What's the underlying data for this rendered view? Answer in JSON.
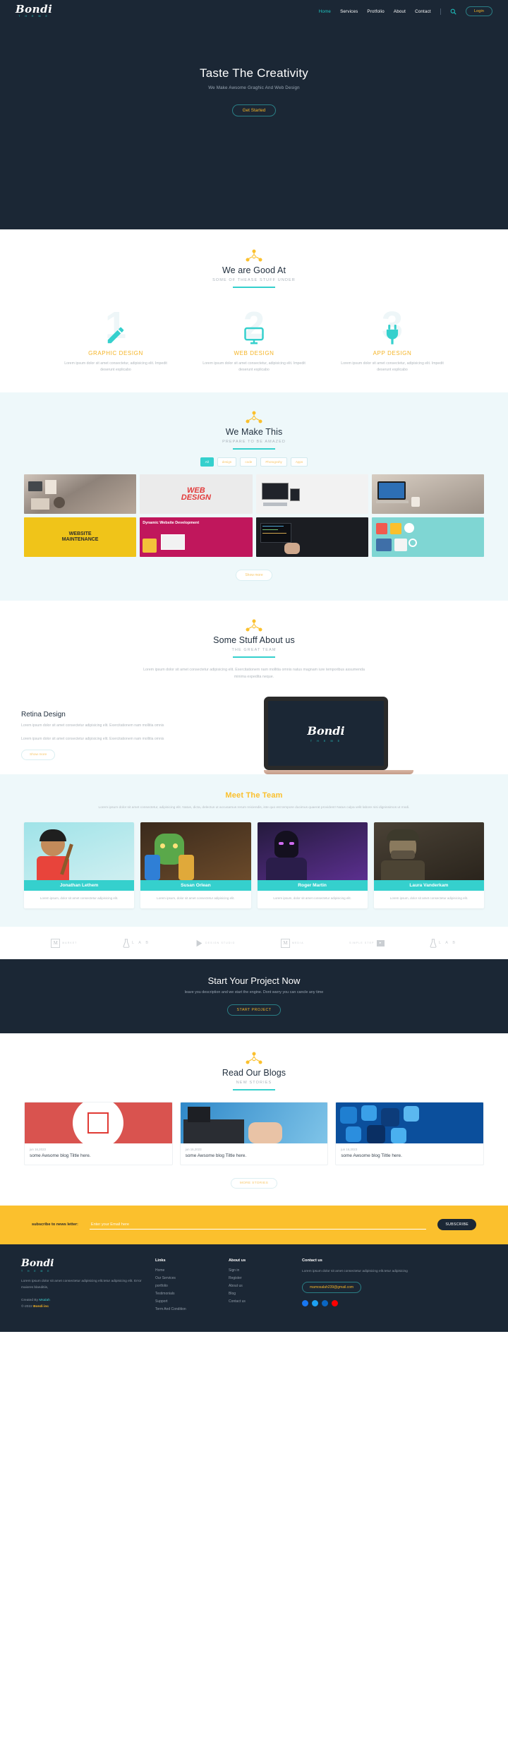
{
  "colors": {
    "dark": "#1b2735",
    "teal": "#35d0cd",
    "yellow": "#fbc02d",
    "amber": "#f5b425",
    "light_bg": "#eef8fa"
  },
  "brand": {
    "name": "Bondi",
    "tagline": "T H E M E"
  },
  "nav": {
    "links": [
      {
        "label": "Home",
        "active": true
      },
      {
        "label": "Services",
        "active": false
      },
      {
        "label": "Protfolio",
        "active": false
      },
      {
        "label": "About",
        "active": false
      },
      {
        "label": "Contact",
        "active": false
      }
    ],
    "search_icon": "search-icon",
    "login_label": "Login"
  },
  "hero": {
    "title": "Taste The Creativity",
    "subtitle": "We Make Awsome Graghic And Web Design",
    "button": "Get Started"
  },
  "goodat": {
    "title": "We are Good At",
    "subtitle": "SOME OF THEASE STUFF UNDER",
    "cards": [
      {
        "number": "1",
        "icon": "pencil-icon",
        "title": "GRAPHIC DESIGN",
        "text": "Lorem ipsum dolor sit amet consectetur, adipisicing elit. Impedit deserunt explicabo"
      },
      {
        "number": "2",
        "icon": "monitor-icon",
        "title": "WEB DESIGN",
        "text": "Lorem ipsum dolor sit amet consectetur, adipisicing elit. Impedit deserunt explicabo"
      },
      {
        "number": "3",
        "icon": "plug-icon",
        "title": "APP DESIGN",
        "text": "Lorem ipsum dolor sit amet consectetur, adipisicing elit. Impedit deserunt explicabo"
      }
    ]
  },
  "portfolio": {
    "title": "We Make This",
    "subtitle": "PREPARE TO BE AMAZED",
    "filters": [
      {
        "label": "All",
        "active": true
      },
      {
        "label": "design",
        "active": false
      },
      {
        "label": "code",
        "active": false
      },
      {
        "label": "Photograhy",
        "active": false
      },
      {
        "label": "Apps",
        "active": false
      }
    ],
    "tiles": [
      {
        "name": "desk-workspace-photo"
      },
      {
        "name": "web-design-poster"
      },
      {
        "name": "responsive-devices-photo"
      },
      {
        "name": "laptop-desk-photo"
      },
      {
        "name": "website-maintenance-poster"
      },
      {
        "name": "dynamic-website-development-poster"
      },
      {
        "name": "coding-screen-photo"
      },
      {
        "name": "app-icons-illustration"
      }
    ],
    "show_more": "Show more"
  },
  "about": {
    "title": "Some Stuff About us",
    "subtitle": "THE GREAT TEAM",
    "lead": "Lorem ipsum dolor sit amet consectetur adipisicing elit. Exercitationem nam mollitia omnis natus magnam iure temporibus assumenda minima expedita neque.",
    "retina_title": "Retina Design",
    "retina_p1": "Lorem ipsum dolor sit amet consectetur adipisicing elit. Exercitationem nam mollitia omnis",
    "retina_p2": "Lorem ipsum dolor sit amet consectetur adipisicing elit. Exercitationem nam mollitia omnis",
    "retina_btn": "Show more",
    "laptop_logo": "Bondi",
    "laptop_sub": "T H E M E"
  },
  "team": {
    "title": "Meet The Team",
    "lead": "Lorem ipsum dolor sit amet consectetur, adipisicing elit. Natus, dicta, delectus ut accusamus rerum reiciendis, iste quo est tempore ducimus quaerat provident! Natus culpa velit labore nisi dignissimos ut modi.",
    "members": [
      {
        "name": "Jonathan Lethem",
        "desc": "Lorem ipsum, dolor sit amet consectetur adipisicing elit.",
        "photo": "cartoon-boy-avatar"
      },
      {
        "name": "Susan Orlean",
        "desc": "Lorem ipsum, dolor sit amet consectetur adipisicing elit.",
        "photo": "green-orc-avatar"
      },
      {
        "name": "Roger Martin",
        "desc": "Lorem ipsum, dolor sit amet consectetur adipisicing elit.",
        "photo": "purple-shadow-avatar"
      },
      {
        "name": "Laura Vanderkam",
        "desc": "Lorem ipsum, dolor sit amet consectetur adipisicing elit.",
        "photo": "soldier-avatar"
      }
    ]
  },
  "brands": [
    {
      "mark": "M",
      "label": "MARKET",
      "type": "box"
    },
    {
      "mark": "",
      "label": "L A B",
      "type": "flask"
    },
    {
      "mark": "",
      "label": "DESIGN STUDIO",
      "type": "play"
    },
    {
      "mark": "M",
      "label": "MEDIA",
      "type": "box"
    },
    {
      "mark": "",
      "label": "SIMPLE STEP",
      "type": "arrow"
    },
    {
      "mark": "",
      "label": "L A B",
      "type": "flask"
    }
  ],
  "cta": {
    "title": "Start Your Project Now",
    "subtitle": "leave you description and we start the engine. Dont warry you can cancle any time",
    "button": "START PROJECT"
  },
  "blogs": {
    "title": "Read Our Blogs",
    "subtitle": "NEW STORIES",
    "posts": [
      {
        "date": "jun 16,2023",
        "title": "some Awsome blog Tiltle here.",
        "image": "red-isometric-box-illustration"
      },
      {
        "date": "jun 16,2023",
        "title": "some Awsome blog Tiltle here.",
        "image": "keyboard-hands-photo"
      },
      {
        "date": "jun 16,2023",
        "title": "some Awsome blog Tiltle here.",
        "image": "blue-app-icons-photo"
      }
    ],
    "more": "MORE STORIES"
  },
  "subscribe": {
    "label": "subscribe to news letter:",
    "placeholder": "Enter your Email here",
    "value": "",
    "button": "SUBSCRIBE"
  },
  "footer": {
    "logo": "Bondi",
    "logo_sub": "T H E M E",
    "about_text": "Lorem ipsum dolor sit amet consectetur adipisicing elit.tetur adipisicing elit. Error maiores blanditiis,",
    "credit_prefix": "Created By ",
    "credit_author": "Msalah",
    "copyright_prefix": "©-2022 ",
    "copyright_brand": "Bondi inc",
    "links_head": "Links",
    "links": [
      "Home",
      "Our Services",
      "portfolio",
      "Testimonials",
      "Support",
      "Term And Condition"
    ],
    "about_head": "About us",
    "about_links": [
      "Sign in",
      "Register",
      "About us",
      "Blog",
      "Contact us"
    ],
    "contact_head": "Contact us",
    "contact_text": "Lorem ipsum dolor sit amet consectetur adipisicing elit.tetur adipisicing",
    "email": "mamosalah239@gmail.com",
    "socials": [
      {
        "name": "facebook-icon",
        "color": "#1877f2"
      },
      {
        "name": "twitter-icon",
        "color": "#1da1f2"
      },
      {
        "name": "linkedin-icon",
        "color": "#0a66c2"
      },
      {
        "name": "youtube-icon",
        "color": "#ff0000"
      }
    ]
  }
}
